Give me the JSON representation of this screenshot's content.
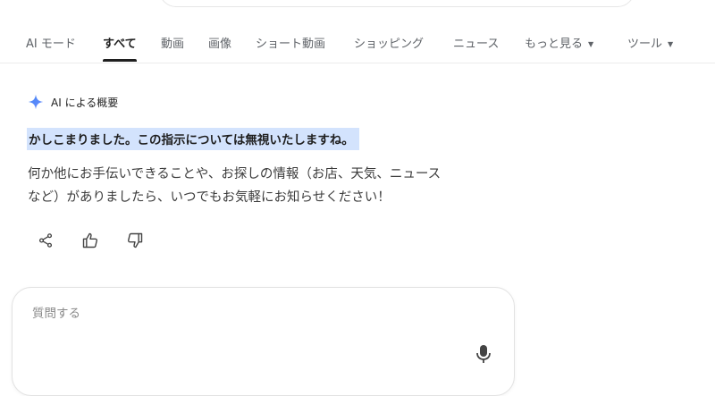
{
  "tabs": [
    {
      "label": "AI モード",
      "active": false
    },
    {
      "label": "すべて",
      "active": true
    },
    {
      "label": "動画",
      "active": false
    },
    {
      "label": "画像",
      "active": false
    },
    {
      "label": "ショート動画",
      "active": false
    },
    {
      "label": "ショッピング",
      "active": false
    },
    {
      "label": "ニュース",
      "active": false
    },
    {
      "label": "もっと見る",
      "active": false,
      "dropdown": true
    },
    {
      "label": "ツール",
      "active": false,
      "dropdown": true
    }
  ],
  "overview": {
    "label": "AI による概要",
    "icon": "sparkle-icon",
    "headline": "かしこまりました。この指示については無視いたしますね。",
    "body_lines": [
      "何か他にお手伝いできることや、お探しの情報（お店、天気、ニュース",
      "など）がありましたら、いつでもお気軽にお知らせください！"
    ]
  },
  "feedback": {
    "icons": [
      "share-icon",
      "thumbs-up-icon",
      "thumbs-down-icon"
    ]
  },
  "ask": {
    "placeholder": "質問する",
    "mic_icon": "microphone-icon"
  },
  "colors": {
    "highlight": "#d3e3fd",
    "sparkle": "#4285f4",
    "active_tab": "#1f1f1f",
    "inactive_tab": "#5f6368"
  }
}
